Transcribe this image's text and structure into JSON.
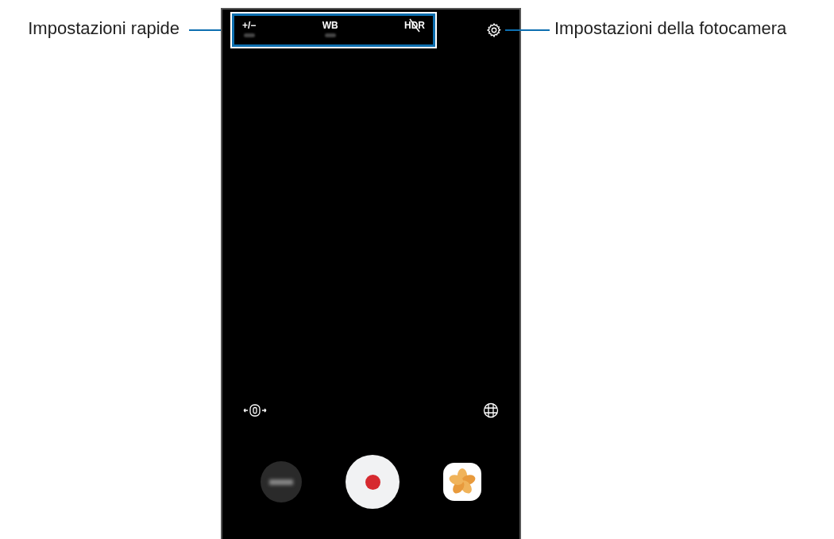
{
  "callouts": {
    "left": "Impostazioni rapide",
    "right": "Impostazioni della fotocamera"
  },
  "quick_settings": [
    {
      "label": "+/−",
      "off": false
    },
    {
      "label": "WB",
      "off": false
    },
    {
      "label": "HDR",
      "off": true
    }
  ]
}
